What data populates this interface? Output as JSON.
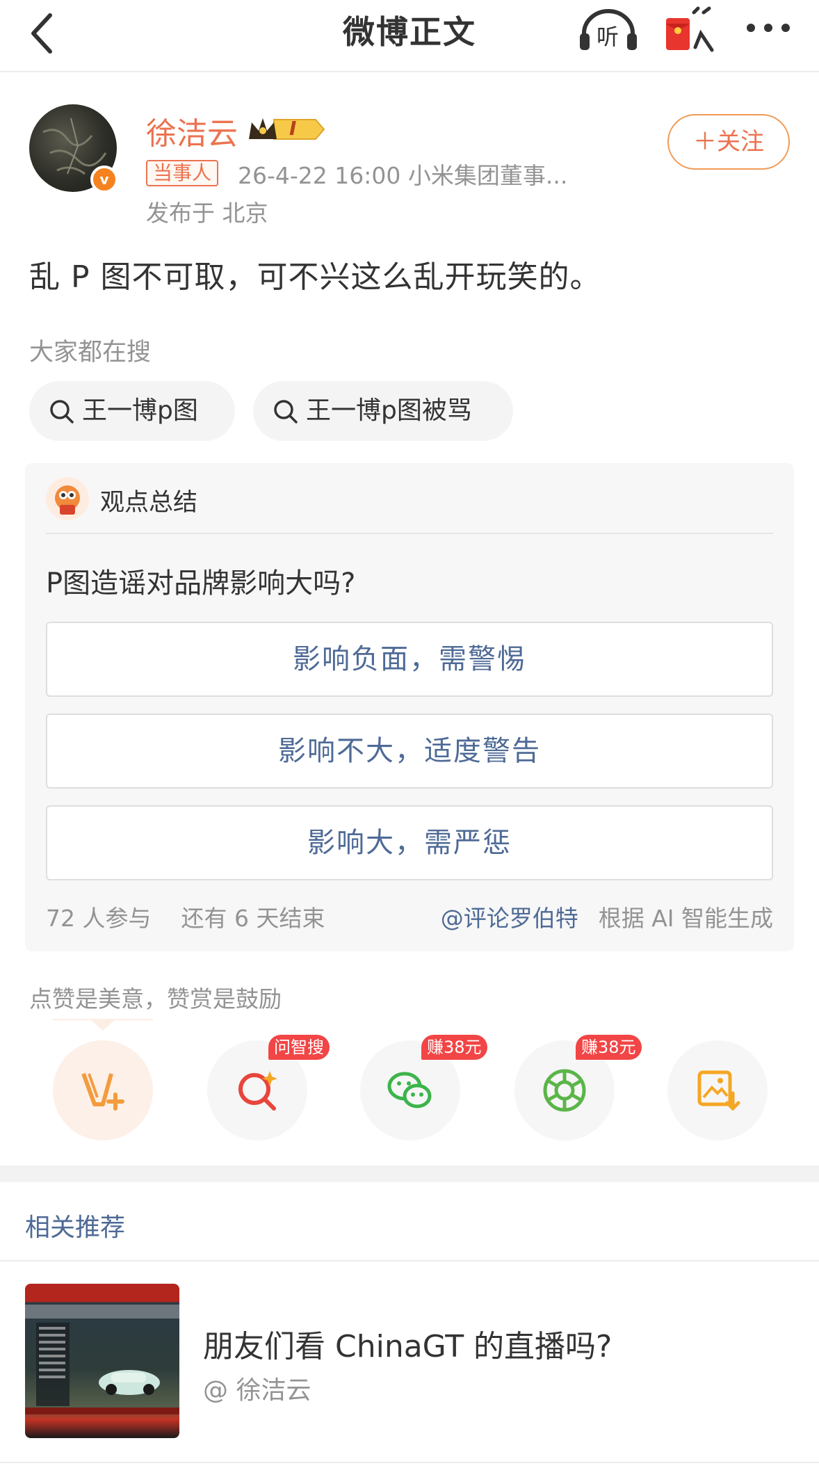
{
  "nav": {
    "title": "微博正文",
    "listen_label": "听"
  },
  "author": {
    "name": "徐洁云",
    "level_badge": "I",
    "role_tag": "当事人",
    "meta": "26-4-22 16:00  小米集团董事...",
    "location": "发布于 北京",
    "follow_label": "＋关注"
  },
  "post": {
    "text": "乱 P 图不可取，可不兴这么乱开玩笑的。"
  },
  "search": {
    "label": "大家都在搜",
    "chips": [
      {
        "label": "王一博p图"
      },
      {
        "label": "王一博p图被骂"
      }
    ]
  },
  "viewpoint": {
    "title": "观点总结",
    "question": "P图造谣对品牌影响大吗?",
    "options": [
      {
        "label": "影响负面，需警惕"
      },
      {
        "label": "影响不大，适度警告"
      },
      {
        "label": "影响大，需严惩"
      }
    ],
    "participants": "72 人参与",
    "remaining": "还有 6 天结束",
    "robot": "@评论罗伯特",
    "ai_note": "根据 AI 智能生成"
  },
  "actions": {
    "hint": "点赞是美意，赞赏是鼓励",
    "badges": {
      "ask": "问智搜",
      "wechat": "赚38元",
      "moments": "赚38元"
    }
  },
  "related": {
    "title": "相关推荐",
    "items": [
      {
        "text": "朋友们看 ChinaGT 的直播吗?",
        "author": "@ 徐洁云"
      }
    ]
  },
  "colors": {
    "accent": "#eb7350",
    "link_blue": "#4e6a96",
    "gray": "#939393"
  }
}
